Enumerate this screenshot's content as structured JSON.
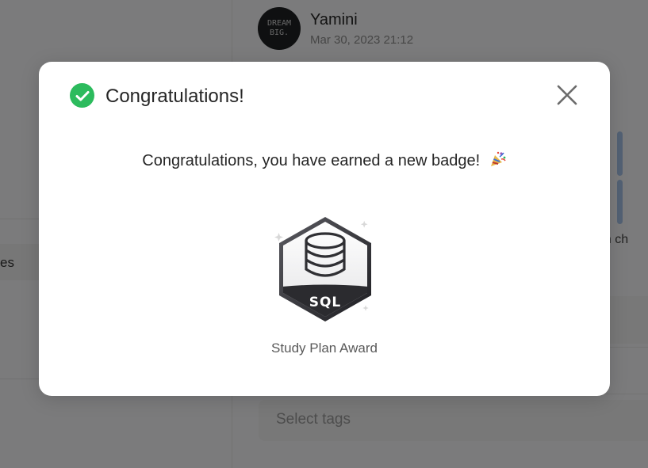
{
  "background": {
    "left_tab_label": "es",
    "post": {
      "avatar_text": [
        "DREAM",
        "BIG."
      ],
      "author": "Yamini",
      "timestamp": "Mar 30, 2023 21:12"
    },
    "snippet": "tion ch",
    "tags_placeholder": "Select tags"
  },
  "modal": {
    "title": "Congratulations!",
    "message": "Congratulations, you have earned a new badge!",
    "badge": {
      "label": "SQL",
      "name": "Study Plan Award"
    },
    "icons": {
      "status": "check-circle-icon",
      "close": "close-icon",
      "celebration": "party-popper-icon"
    },
    "colors": {
      "success": "#2cbb5d",
      "overlay": "rgba(0,0,0,0.5)"
    }
  }
}
